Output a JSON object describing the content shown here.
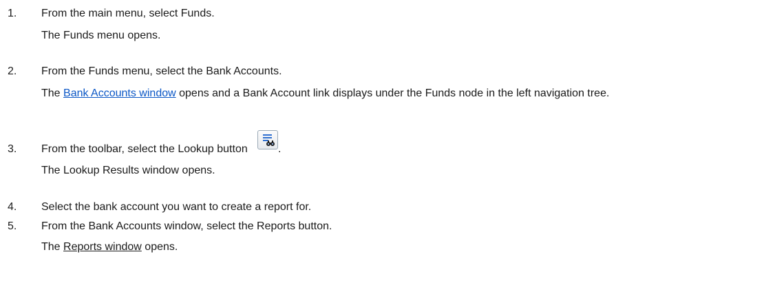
{
  "steps": [
    {
      "number": "1.",
      "instruction": "From the main menu, select Funds.",
      "result": "The Funds menu opens."
    },
    {
      "number": "2.",
      "instruction": "From the Funds menu, select the Bank Accounts.",
      "result_prefix": "The ",
      "result_link": "Bank Accounts window",
      "result_suffix": " opens and a Bank Account link displays under the Funds node in the left navigation tree."
    },
    {
      "number": "3.",
      "instruction": "From the toolbar, select the Lookup button",
      "instruction_end": ".",
      "icon": "lookup-binoculars-icon",
      "result": "The Lookup Results window opens."
    },
    {
      "number": "4.",
      "instruction": "Select the bank account you want to create a report for."
    },
    {
      "number": "5.",
      "instruction": "From the Bank Accounts window, select the Reports button.",
      "result_prefix": "The ",
      "result_link": "Reports window",
      "result_suffix": " opens."
    }
  ],
  "colors": {
    "link": "#0b57c6",
    "text": "#1a1a1a",
    "icon_blue": "#2f6fd0"
  }
}
